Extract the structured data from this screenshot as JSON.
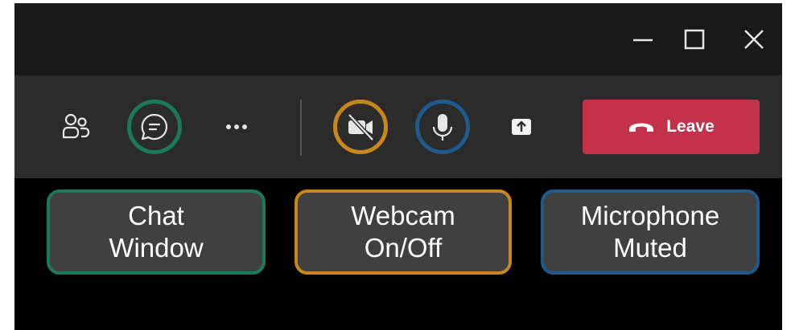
{
  "window_controls": {
    "minimize_icon": "minimize-icon",
    "maximize_icon": "maximize-icon",
    "close_icon": "close-icon"
  },
  "toolbar": {
    "buttons": [
      {
        "name": "participants",
        "icon": "people-icon"
      },
      {
        "name": "chat",
        "icon": "chat-icon",
        "highlight": "#1b7a5a"
      },
      {
        "name": "more",
        "icon": "more-dots-icon"
      },
      {
        "name": "camera",
        "icon": "camera-off-icon",
        "highlight": "#c9861b"
      },
      {
        "name": "microphone",
        "icon": "microphone-icon",
        "highlight": "#1f5a8a"
      },
      {
        "name": "share",
        "icon": "share-icon"
      }
    ],
    "leave": {
      "label": "Leave",
      "icon": "phone-hangup-icon",
      "color": "#c4314b"
    }
  },
  "callouts": [
    {
      "line1": "Chat",
      "line2": "Window",
      "color": "#1b7a5a"
    },
    {
      "line1": "Webcam",
      "line2": "On/Off",
      "color": "#c9861b"
    },
    {
      "line1": "Microphone",
      "line2": "Muted",
      "color": "#1f5a8a"
    }
  ]
}
